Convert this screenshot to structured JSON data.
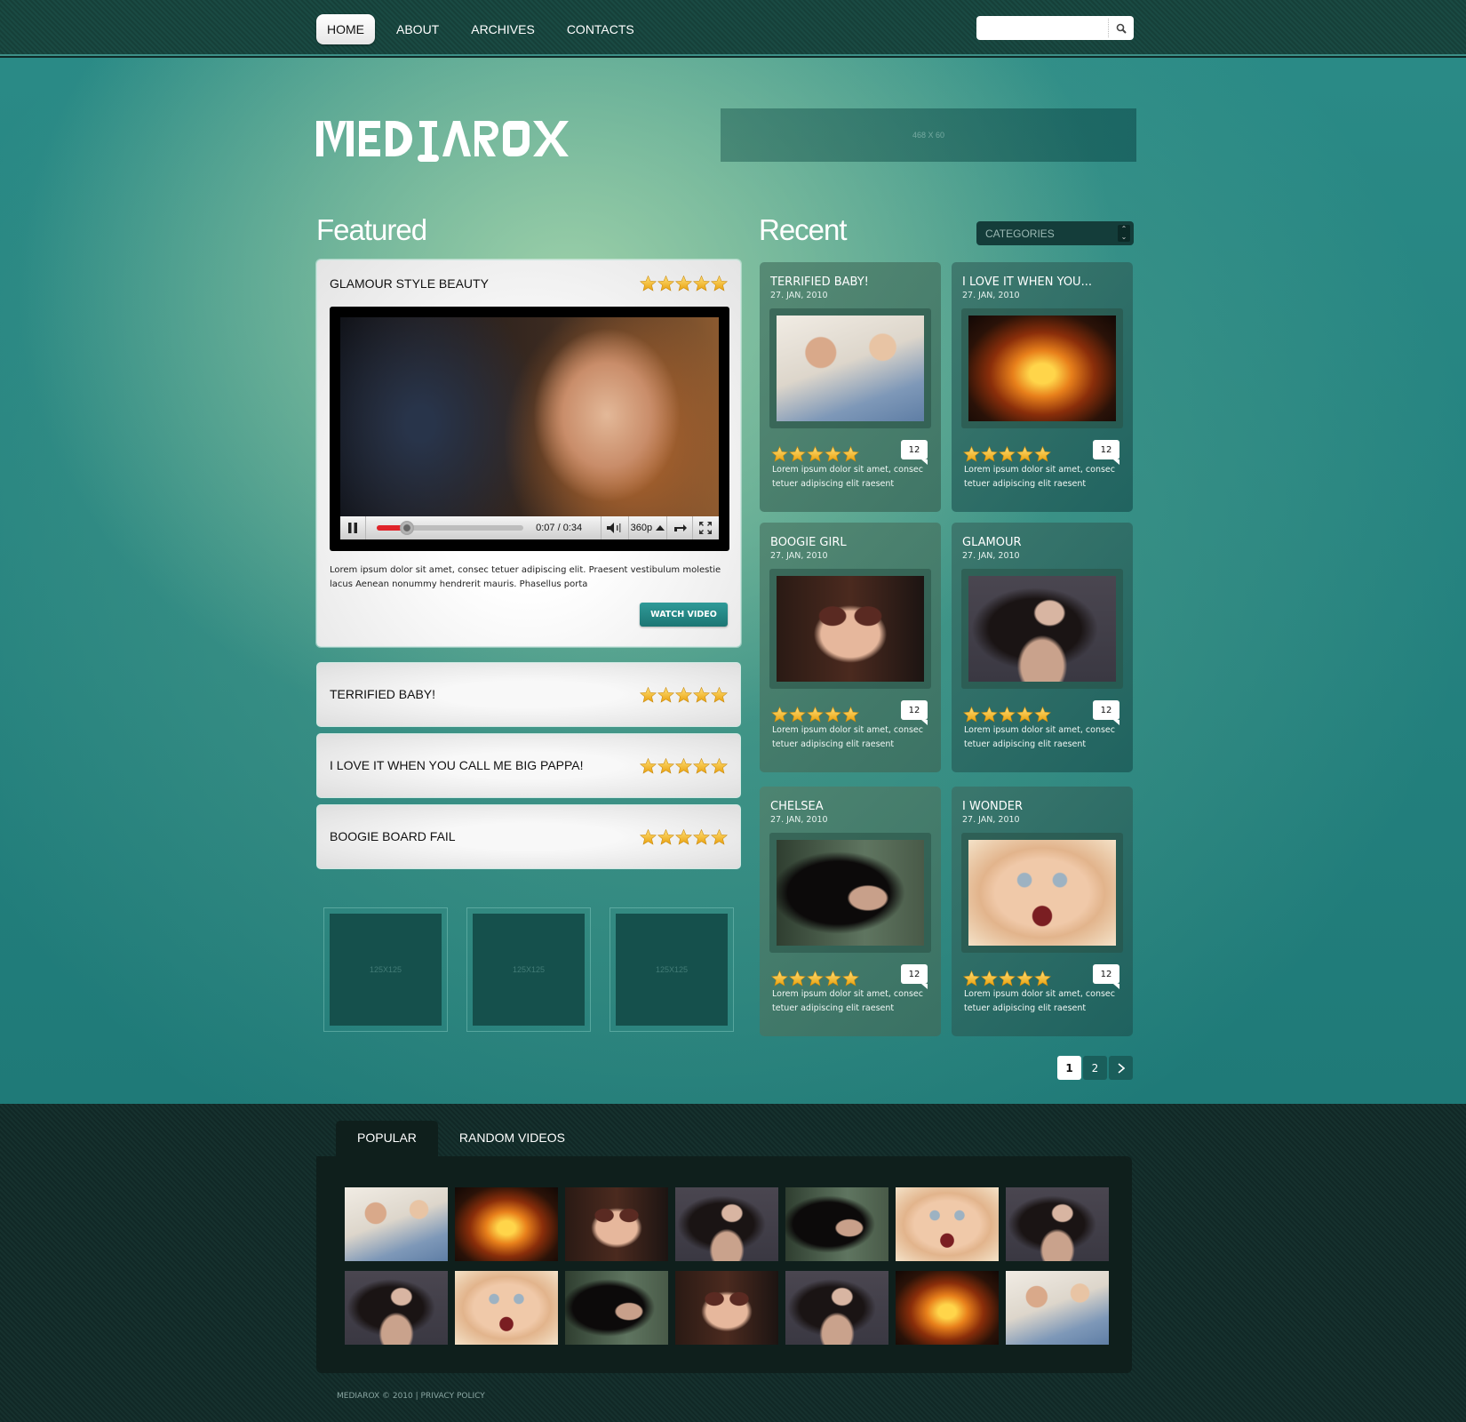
{
  "nav": {
    "items": [
      {
        "label": "HOME",
        "active": true
      },
      {
        "label": "ABOUT",
        "active": false
      },
      {
        "label": "ARCHIVES",
        "active": false
      },
      {
        "label": "CONTACTS",
        "active": false
      }
    ],
    "search": {
      "value": "",
      "placeholder": "",
      "icon": "search-icon"
    }
  },
  "header": {
    "logo_text": "MEDIAROX",
    "ad_banner_label": "468 X 60"
  },
  "featured": {
    "section_title": "Featured",
    "main": {
      "title": "GLAMOUR STYLE BEAUTY",
      "rating": 5,
      "rating_max": 5,
      "player": {
        "time_current": "0:07",
        "time_total": "0:34",
        "time_display": "0:07 / 0:34",
        "progress_fraction": 0.206,
        "quality": "360p",
        "icons": [
          "pause-icon",
          "volume-icon",
          "quality-up-icon",
          "popout-icon",
          "fullscreen-icon"
        ]
      },
      "description": "Lorem ipsum dolor sit amet, consec tetuer adipiscing elit. Praesent vestibulum molestie lacus Aenean nonummy hendrerit mauris. Phasellus porta",
      "button_label": "WATCH VIDEO"
    },
    "list": [
      {
        "title": "TERRIFIED BABY!",
        "rating": 5
      },
      {
        "title": "I LOVE IT WHEN YOU CALL ME BIG PAPPA!",
        "rating": 5
      },
      {
        "title": "BOOGIE BOARD FAIL",
        "rating": 5
      }
    ],
    "ads": [
      "125X125",
      "125X125",
      "125X125"
    ]
  },
  "recent": {
    "section_title": "Recent",
    "categories_select": {
      "selected": "CATEGORIES"
    },
    "cards": [
      {
        "title": "TERRIFIED BABY!",
        "date": "27. JAN, 2010",
        "rating": 5,
        "comments": "12",
        "description": "Lorem ipsum dolor sit amet, consec tetuer adipiscing elit raesent",
        "image": "family"
      },
      {
        "title": "I LOVE IT WHEN YOU...",
        "date": "27. JAN, 2010",
        "rating": 5,
        "comments": "12",
        "description": "Lorem ipsum dolor sit amet, consec tetuer adipiscing elit raesent",
        "image": "pumpkin"
      },
      {
        "title": "BOOGIE GIRL",
        "date": "27. JAN, 2010",
        "rating": 5,
        "comments": "12",
        "description": "Lorem ipsum dolor sit amet, consec tetuer adipiscing elit raesent",
        "image": "sunglasses"
      },
      {
        "title": "GLAMOUR",
        "date": "27. JAN, 2010",
        "rating": 5,
        "comments": "12",
        "description": "Lorem ipsum dolor sit amet, consec tetuer adipiscing elit raesent",
        "image": "glamour"
      },
      {
        "title": "CHELSEA",
        "date": "27. JAN, 2010",
        "rating": 5,
        "comments": "12",
        "description": "Lorem ipsum dolor sit amet, consec tetuer adipiscing elit raesent",
        "image": "chelsea"
      },
      {
        "title": "I WONDER",
        "date": "27. JAN, 2010",
        "rating": 5,
        "comments": "12",
        "description": "Lorem ipsum dolor sit amet, consec tetuer adipiscing elit raesent",
        "image": "wonder"
      }
    ],
    "pagination": {
      "pages": [
        "1",
        "2"
      ],
      "current": "1",
      "next_icon": "chevron-right-icon"
    }
  },
  "bottom": {
    "tabs": [
      {
        "label": "POPULAR",
        "active": true
      },
      {
        "label": "RANDOM VIDEOS",
        "active": false
      }
    ],
    "gallery": [
      [
        "family",
        "pumpkin",
        "sunglasses",
        "glamour",
        "chelsea",
        "wonder",
        "glamour"
      ],
      [
        "glamour",
        "wonder",
        "chelsea",
        "sunglasses",
        "glamour",
        "pumpkin",
        "family"
      ]
    ]
  },
  "footer": {
    "copyright": "MEDIAROX © 2010",
    "separator": "|",
    "privacy_label": "PRIVACY POLICY"
  }
}
